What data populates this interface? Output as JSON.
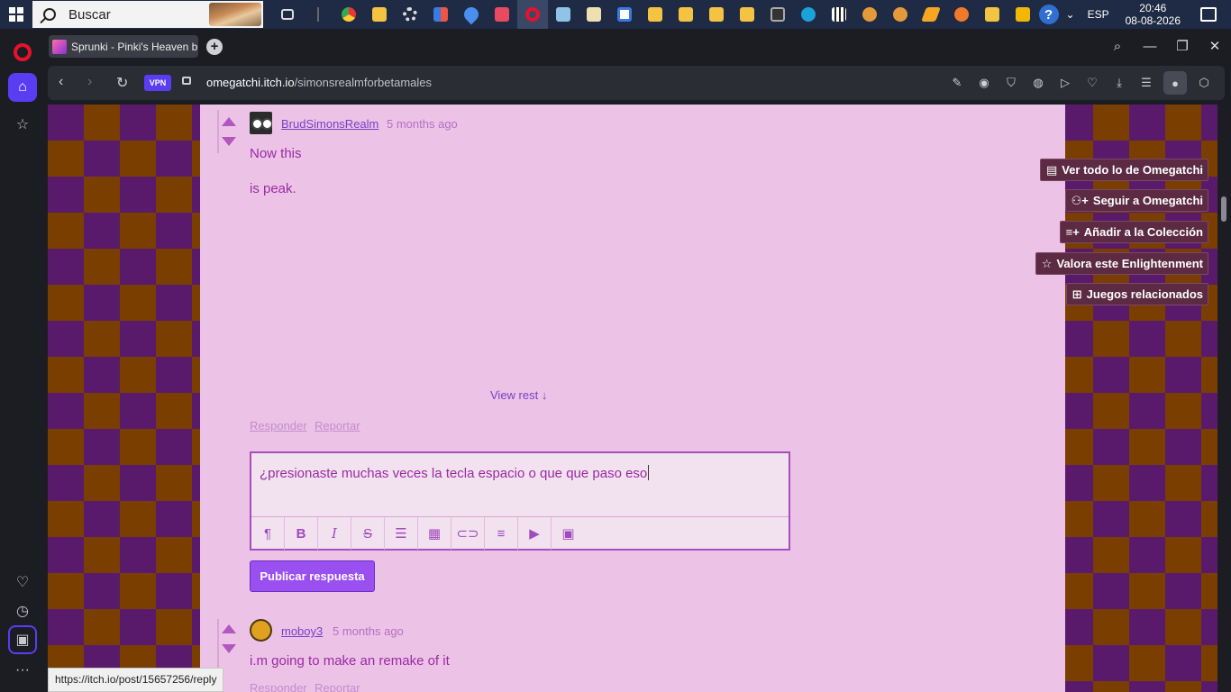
{
  "taskbar": {
    "search_placeholder": "Buscar",
    "language": "ESP",
    "time": "20:46",
    "date": "08-08-2026",
    "pinned_icons": [
      "task-view",
      "chrome",
      "file-explorer",
      "settings",
      "git",
      "drop",
      "app-red",
      "opera",
      "notes",
      "editor",
      "app-grid",
      "folder",
      "folder",
      "folder",
      "folder",
      "terminal",
      "app-cyan",
      "qr",
      "game-cat",
      "game-cat",
      "app-orange",
      "app-fox",
      "folder",
      "app-yellow"
    ]
  },
  "browser": {
    "tab_title": "Sprunki - Pinki's Heaven b",
    "vpn_label": "VPN",
    "url_domain": "omegatchi.itch.io",
    "url_path": "/simonsrealmforbetamales"
  },
  "page": {
    "comment1": {
      "author": "BrudSimonsRealm",
      "time": "5 months ago",
      "line1": "Now this",
      "line2": "is peak.",
      "view_rest": "View rest ↓",
      "reply": "Responder",
      "report": "Reportar"
    },
    "editor": {
      "value": "¿presionaste muchas veces la tecla espacio o que que paso eso",
      "tools": [
        "¶",
        "B",
        "I",
        "S",
        "list",
        "grid",
        "link",
        "align",
        "video",
        "image"
      ]
    },
    "publish_label": "Publicar respuesta",
    "comment2": {
      "author": "moboy3",
      "time": "5 months ago",
      "body": "i.m going to make an remake of it",
      "reply": "Responder",
      "report": "Reportar"
    },
    "side_actions": {
      "view_all": "Ver todo lo de Omegatchi",
      "follow": "Seguir a Omegatchi",
      "add_collection": "Añadir a la Colección",
      "rate": "Valora este Enlightenment",
      "related": "Juegos relacionados"
    }
  },
  "status_url": "https://itch.io/post/15657256/reply",
  "colors": {
    "page_bg": "#ecc3e6",
    "accent": "#9a4ff0",
    "text": "#9a2ba2",
    "checker_a": "#5a1a6b",
    "checker_b": "#7a3e00"
  }
}
